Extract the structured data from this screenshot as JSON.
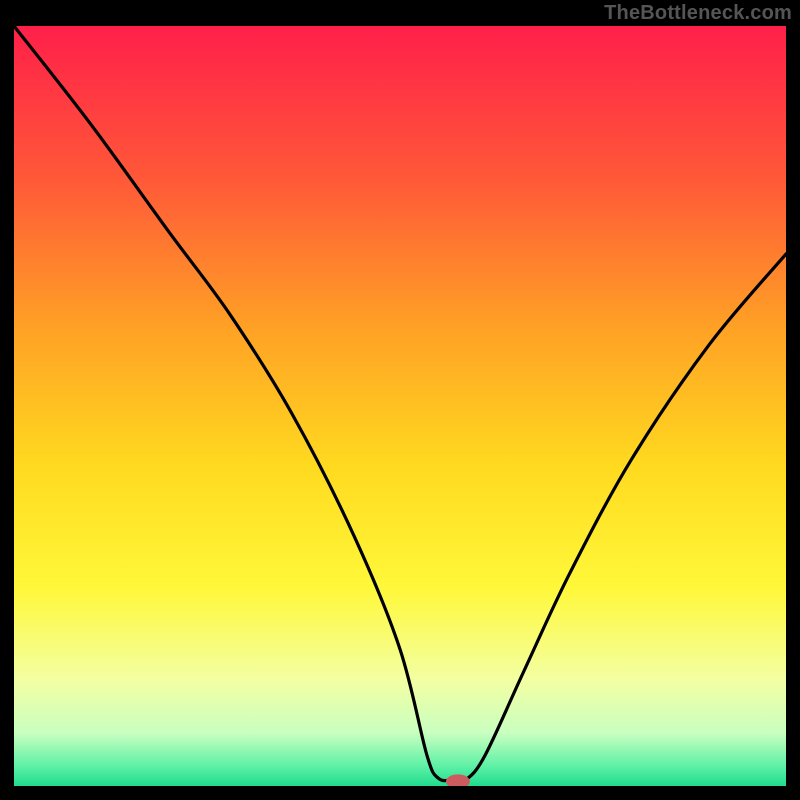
{
  "watermark": "TheBottleneck.com",
  "chart_data": {
    "type": "line",
    "title": "",
    "xlabel": "",
    "ylabel": "",
    "xlim": [
      0,
      100
    ],
    "ylim": [
      0,
      100
    ],
    "grid": false,
    "legend": false,
    "series": [
      {
        "name": "bottleneck-curve",
        "x": [
          0,
          10,
          20,
          28,
          36,
          44,
          50,
          53.5,
          55,
          57,
          58.5,
          61,
          66,
          72,
          80,
          90,
          100
        ],
        "values": [
          100,
          87,
          73,
          62,
          49,
          33,
          18,
          4,
          1,
          0.8,
          0.8,
          4,
          15,
          28,
          43,
          58,
          70
        ]
      }
    ],
    "marker": {
      "x": 57.5,
      "y": 0.6,
      "color": "#cb5b5e",
      "rx": 12,
      "ry": 7
    },
    "background_gradient": {
      "stops": [
        {
          "offset": 0.0,
          "color": "#ff1f4a"
        },
        {
          "offset": 0.2,
          "color": "#ff5838"
        },
        {
          "offset": 0.4,
          "color": "#ffa225"
        },
        {
          "offset": 0.58,
          "color": "#ffda1f"
        },
        {
          "offset": 0.74,
          "color": "#fff83a"
        },
        {
          "offset": 0.86,
          "color": "#f3ffa2"
        },
        {
          "offset": 0.93,
          "color": "#c9ffc0"
        },
        {
          "offset": 0.975,
          "color": "#5bf0a6"
        },
        {
          "offset": 1.0,
          "color": "#1fdc8d"
        }
      ]
    }
  }
}
